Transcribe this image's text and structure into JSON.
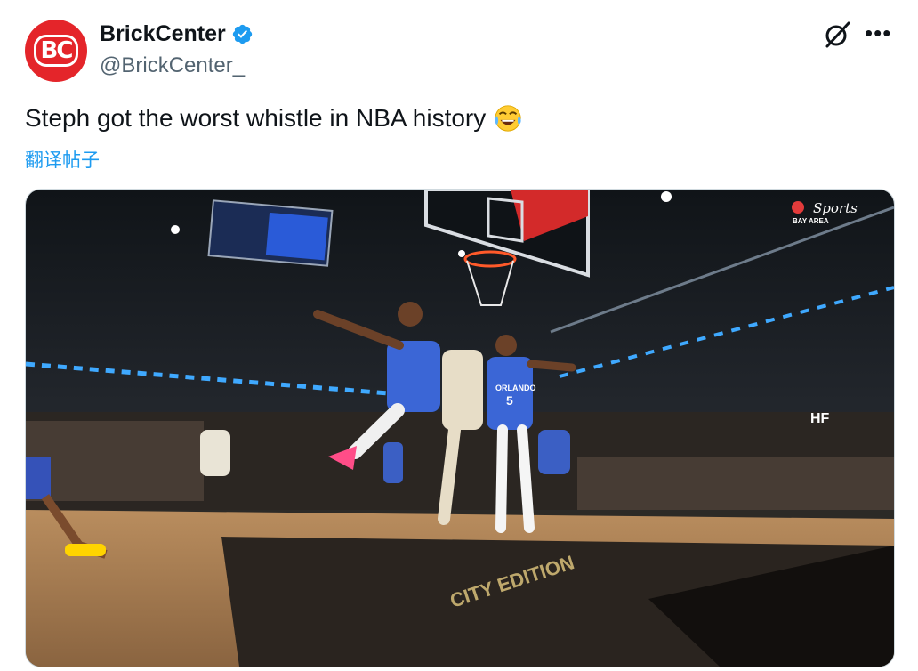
{
  "author": {
    "name": "BrickCenter",
    "handle": "@BrickCenter_",
    "avatar_text": "BC",
    "verified": true,
    "avatar_color": "#e4252a",
    "badge_color": "#1d9bf0"
  },
  "tweet": {
    "text": "Steph got the worst whistle in NBA history",
    "emoji": "face-with-tears-of-joy",
    "translate_label": "翻译帖子"
  },
  "media": {
    "broadcast_logo_text": "Sports",
    "broadcast_logo_sub": "BAY AREA",
    "court_text": "CITY EDITION",
    "jersey_number": "5",
    "jersey_text": "ORLANDO",
    "arena_sign": "HF"
  },
  "icons": [
    "grok-icon",
    "more-icon",
    "verified-badge-icon"
  ]
}
